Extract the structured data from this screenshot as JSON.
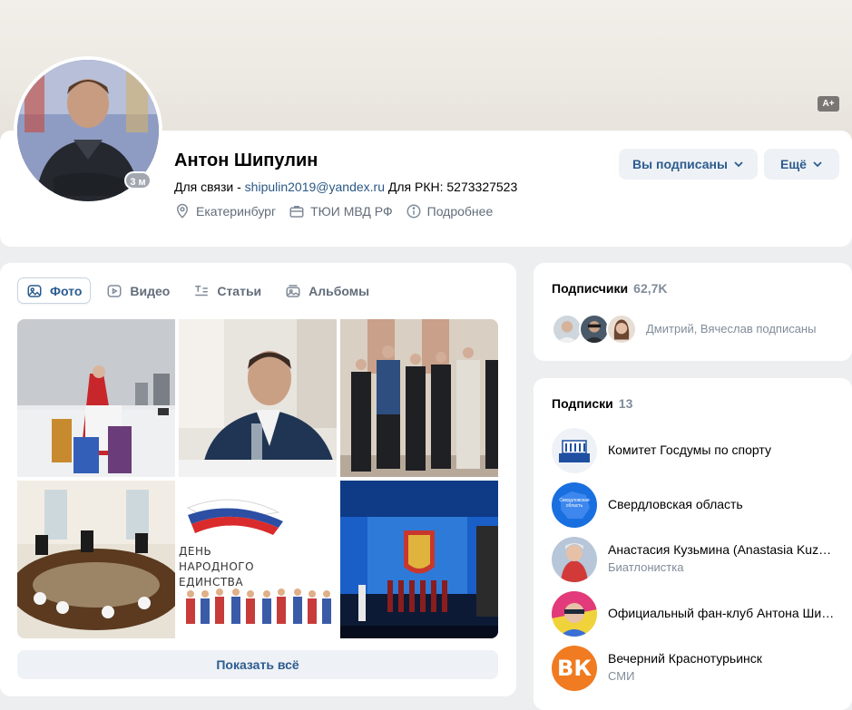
{
  "cover": {
    "badge": "A+"
  },
  "profile": {
    "name": "Антон Шипулин",
    "online": "3 м",
    "status_prefix": "Для связи - ",
    "status_link": "shipulin2019@yandex.ru",
    "status_suffix": " Для РКН: 5273327523",
    "city": "Екатеринбург",
    "work": "ТЮИ МВД РФ",
    "more_info": "Подробнее",
    "subscribed_label": "Вы подписаны",
    "more_label": "Ещё"
  },
  "media": {
    "tabs": [
      {
        "label": "Фото",
        "icon": "photo-icon",
        "active": true
      },
      {
        "label": "Видео",
        "icon": "video-icon",
        "active": false
      },
      {
        "label": "Статьи",
        "icon": "article-icon",
        "active": false
      },
      {
        "label": "Альбомы",
        "icon": "albums-icon",
        "active": false
      }
    ],
    "photo4_text": [
      "ДЕНЬ",
      "НАРОДНОГО",
      "ЕДИНСТВА"
    ],
    "show_all": "Показать всё"
  },
  "followers": {
    "title": "Подписчики",
    "count": "62,7K",
    "text": "Дмитрий, Вячеслав подписаны"
  },
  "following": {
    "title": "Подписки",
    "count": "13",
    "items": [
      {
        "title": "Комитет Госдумы по спорту",
        "subtitle": ""
      },
      {
        "title": "Свердловская область",
        "subtitle": "",
        "logo_text": "Свердловская область"
      },
      {
        "title": "Анастасия Кузьмина (Anastasia Kuzmina)",
        "subtitle": "Биатлонистка"
      },
      {
        "title": "Официальный фан-клуб Антона Шипулина",
        "subtitle": ""
      },
      {
        "title": "Вечерний Краснотурьинск",
        "subtitle": "СМИ",
        "logo_text": "ВК"
      }
    ]
  },
  "colors": {
    "accent": "#2c5c8f",
    "link": "#2a5885",
    "muted": "#818c99",
    "bg": "#edeef0"
  }
}
